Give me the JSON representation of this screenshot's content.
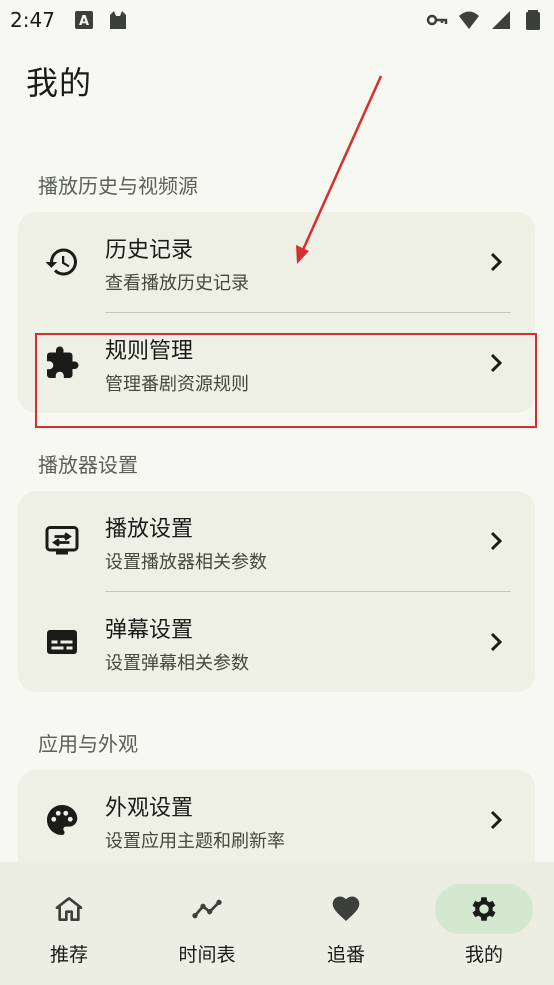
{
  "status_bar": {
    "time": "2:47",
    "left_icons": [
      "a-box-icon",
      "cat-icon"
    ],
    "right_icons": [
      "key-icon",
      "wifi-icon",
      "signal-icon",
      "battery-icon"
    ]
  },
  "page": {
    "title": "我的"
  },
  "sections": [
    {
      "header": "播放历史与视频源",
      "items": [
        {
          "title": "历史记录",
          "subtitle": "查看播放历史记录",
          "icon": "history-icon"
        },
        {
          "title": "规则管理",
          "subtitle": "管理番剧资源规则",
          "icon": "puzzle-icon"
        }
      ]
    },
    {
      "header": "播放器设置",
      "items": [
        {
          "title": "播放设置",
          "subtitle": "设置播放器相关参数",
          "icon": "player-settings-icon"
        },
        {
          "title": "弹幕设置",
          "subtitle": "设置弹幕相关参数",
          "icon": "subtitles-icon"
        }
      ]
    },
    {
      "header": "应用与外观",
      "items": [
        {
          "title": "外观设置",
          "subtitle": "设置应用主题和刷新率",
          "icon": "palette-icon"
        }
      ]
    }
  ],
  "bottom_nav": [
    {
      "label": "推荐",
      "icon": "home-icon",
      "active": false
    },
    {
      "label": "时间表",
      "icon": "timeline-icon",
      "active": false
    },
    {
      "label": "追番",
      "icon": "heart-icon",
      "active": false
    },
    {
      "label": "我的",
      "icon": "gear-icon",
      "active": true
    }
  ],
  "colors": {
    "background": "#f7f8f1",
    "card": "#eef0e6",
    "nav_background": "#eceee4",
    "nav_active_pill": "#d4e8cf",
    "annotation_red": "#d62f2f"
  }
}
